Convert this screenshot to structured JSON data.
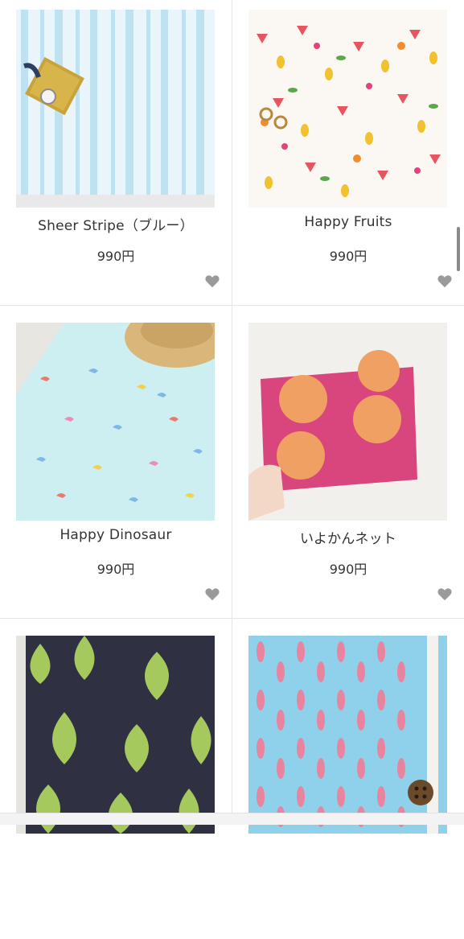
{
  "products": [
    {
      "name": "Sheer Stripe（ブルー）",
      "price": "990円",
      "image": "sheer-stripe-blue-fabric"
    },
    {
      "name": "Happy Fruits",
      "price": "990円",
      "image": "happy-fruits-fabric"
    },
    {
      "name": "Happy Dinosaur",
      "price": "990円",
      "image": "happy-dinosaur-fabric"
    },
    {
      "name": "いよかんネット",
      "price": "990円",
      "image": "iyokan-net-fabric"
    },
    {
      "name": "",
      "price": "",
      "image": "green-net-navy-fabric"
    },
    {
      "name": "",
      "price": "",
      "image": "pink-drops-blue-fabric"
    }
  ],
  "icons": {
    "favorite": "heart-icon"
  },
  "colors": {
    "heart": "#9a9a9a",
    "divider": "#e6e6e6",
    "text": "#333333"
  }
}
